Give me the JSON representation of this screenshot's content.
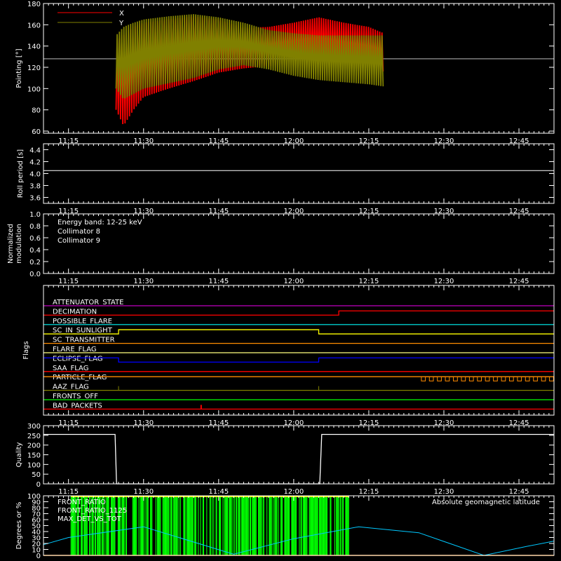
{
  "time_axis": {
    "start_minutes": 670,
    "end_minutes": 772,
    "tick_minutes": [
      675,
      690,
      705,
      720,
      735,
      750,
      765
    ],
    "tick_labels": [
      "11:15",
      "11:30",
      "11:45",
      "12:00",
      "12:15",
      "12:30",
      "12:45"
    ]
  },
  "colors": {
    "background": "#000000",
    "axis": "#ffffff",
    "x_series": "#ff0000",
    "y_series": "#808000",
    "collimator_8": "#00ffff",
    "collimator_9": "#ff00ff",
    "quality": "#ffffff",
    "front_ratio": "#ffff00",
    "front_ratio_1125": "#00ff00",
    "max_det_vs_tot": "#ff8c00",
    "geomag": "#00c8ff"
  },
  "chart_data": [
    {
      "type": "line",
      "id": "pointing",
      "title": "",
      "ylabel": "Pointing [°]",
      "ylim": [
        58,
        180
      ],
      "yticks": [
        60,
        80,
        100,
        120,
        140,
        160,
        180
      ],
      "reference_line": 128,
      "data_window_minutes": [
        684.5,
        738
      ],
      "series": [
        {
          "name": "X",
          "color": "#ff0000",
          "x": [
            684.5,
            686,
            688,
            690,
            695,
            700,
            705,
            710,
            715,
            720,
            725,
            730,
            735,
            738
          ],
          "upper": [
            145,
            150,
            158,
            162,
            165,
            168,
            165,
            157,
            158,
            162,
            167,
            162,
            158,
            152
          ],
          "lower": [
            80,
            65,
            80,
            92,
            100,
            107,
            115,
            119,
            121,
            124,
            124,
            121,
            118,
            116
          ]
        },
        {
          "name": "Y",
          "color": "#808000",
          "x": [
            684.5,
            686,
            688,
            690,
            695,
            700,
            705,
            710,
            715,
            720,
            725,
            730,
            735,
            738
          ],
          "upper": [
            150,
            158,
            162,
            165,
            168,
            170,
            167,
            162,
            155,
            152,
            150,
            150,
            150,
            150
          ],
          "lower": [
            100,
            90,
            95,
            100,
            105,
            110,
            118,
            122,
            118,
            112,
            108,
            106,
            104,
            102
          ]
        }
      ],
      "legend": [
        {
          "label": "X",
          "color": "#ff0000"
        },
        {
          "label": "Y",
          "color": "#808000"
        }
      ]
    },
    {
      "type": "line",
      "id": "roll_period",
      "ylabel": "Roll period [s]",
      "ylim": [
        3.5,
        4.5
      ],
      "yticks": [
        3.6,
        3.8,
        4.0,
        4.2,
        4.4
      ],
      "series": [
        {
          "name": "",
          "x": [
            670,
            772
          ],
          "y": [
            4.05,
            4.05
          ],
          "color": "#ffffff"
        }
      ]
    },
    {
      "type": "line",
      "id": "modulation",
      "ylabel": "Normalized modulation",
      "ylabel_lines": [
        "Normalized",
        "modulation"
      ],
      "ylim": [
        0,
        1
      ],
      "yticks": [
        0.0,
        0.2,
        0.4,
        0.6,
        0.8,
        1.0
      ],
      "annotation": "Energy band: 12-25 keV",
      "legend": [
        {
          "label": "Collimator 8",
          "color": "#00ffff"
        },
        {
          "label": "Collimator 9",
          "color": "#ff00ff"
        }
      ],
      "series": [
        {
          "name": "Collimator 9",
          "x": [
            670,
            772
          ],
          "y": [
            0,
            0
          ],
          "color": "#ff00ff"
        }
      ]
    },
    {
      "type": "line",
      "id": "flags",
      "ylabel": "Flags",
      "flags": [
        {
          "name": "ATTENUATOR_STATE",
          "color": "#c000c0",
          "segments": [
            [
              670,
              0
            ],
            [
              772,
              0
            ]
          ]
        },
        {
          "name": "DECIMATION",
          "color": "#ff0000",
          "segments": [
            [
              670,
              0
            ],
            [
              729,
              0
            ],
            [
              729,
              1
            ],
            [
              772,
              1
            ]
          ]
        },
        {
          "name": "POSSIBLE_FLARE",
          "color": "#00cccc",
          "segments": [
            [
              670,
              0
            ],
            [
              772,
              0
            ]
          ]
        },
        {
          "name": "SC_IN_SUNLIGHT",
          "color": "#ffff00",
          "segments": [
            [
              670,
              0
            ],
            [
              685,
              0
            ],
            [
              685,
              1
            ],
            [
              725,
              1
            ],
            [
              725,
              0
            ],
            [
              772,
              0
            ]
          ]
        },
        {
          "name": "SC_TRANSMITTER",
          "color": "#ff8c00",
          "segments": [
            [
              670,
              0
            ],
            [
              772,
              0
            ]
          ]
        },
        {
          "name": "FLARE_FLAG",
          "color": "#ffff80",
          "segments": [
            [
              670,
              0
            ],
            [
              772,
              0
            ]
          ]
        },
        {
          "name": "ECLIPSE_FLAG",
          "color": "#0000ff",
          "segments": [
            [
              670,
              1
            ],
            [
              685,
              1
            ],
            [
              685,
              0
            ],
            [
              725,
              0
            ],
            [
              725,
              1
            ],
            [
              772,
              1
            ]
          ]
        },
        {
          "name": "SAA_FLAG",
          "color": "#ff0000",
          "segments": [
            [
              670,
              0
            ],
            [
              772,
              0
            ]
          ]
        },
        {
          "name": "PARTICLE_FLAG",
          "color": "#ff8c00",
          "segments": [
            [
              670,
              1
            ],
            [
              772,
              1
            ]
          ]
        },
        {
          "name": "AAZ_FLAG",
          "color": "#808000",
          "segments": [
            [
              670,
              0
            ],
            [
              772,
              0
            ]
          ]
        },
        {
          "name": "FRONTS_OFF",
          "color": "#00ff00",
          "segments": [
            [
              670,
              0
            ],
            [
              772,
              0
            ]
          ]
        },
        {
          "name": "BAD_PACKETS",
          "color": "#ff0000",
          "segments": [
            [
              670,
              0
            ],
            [
              772,
              0
            ]
          ]
        }
      ]
    },
    {
      "type": "line",
      "id": "quality",
      "ylabel": "Quality",
      "ylim": [
        0,
        300
      ],
      "yticks": [
        0,
        50,
        100,
        150,
        200,
        250,
        300
      ],
      "series": [
        {
          "name": "",
          "color": "#ffffff",
          "x": [
            670,
            684.3,
            684.6,
            725.2,
            725.6,
            772
          ],
          "y": [
            255,
            255,
            0,
            0,
            255,
            255
          ]
        }
      ]
    },
    {
      "type": "line",
      "id": "front_ratio",
      "ylabel": "Degrees or %",
      "ylim": [
        0,
        100
      ],
      "yticks": [
        0,
        10,
        20,
        30,
        40,
        50,
        60,
        70,
        80,
        90,
        100
      ],
      "legend": [
        {
          "label": "FRONT_RATIO",
          "color": "#ffff00"
        },
        {
          "label": "FRONT_RATIO_1125",
          "color": "#00ff00"
        },
        {
          "label": "MAX_DET_VS_TOT",
          "color": "#ff8c00"
        }
      ],
      "geomag_label": "Absolute geomagnetic latitude",
      "geomag": {
        "x": [
          670,
          675,
          690,
          708,
          720,
          733,
          745,
          758,
          766.5,
          772
        ],
        "y": [
          18,
          30,
          48,
          2,
          28,
          48,
          38,
          0,
          15,
          24
        ]
      },
      "front_ratio_window_minutes": [
        675.5,
        731
      ]
    }
  ]
}
